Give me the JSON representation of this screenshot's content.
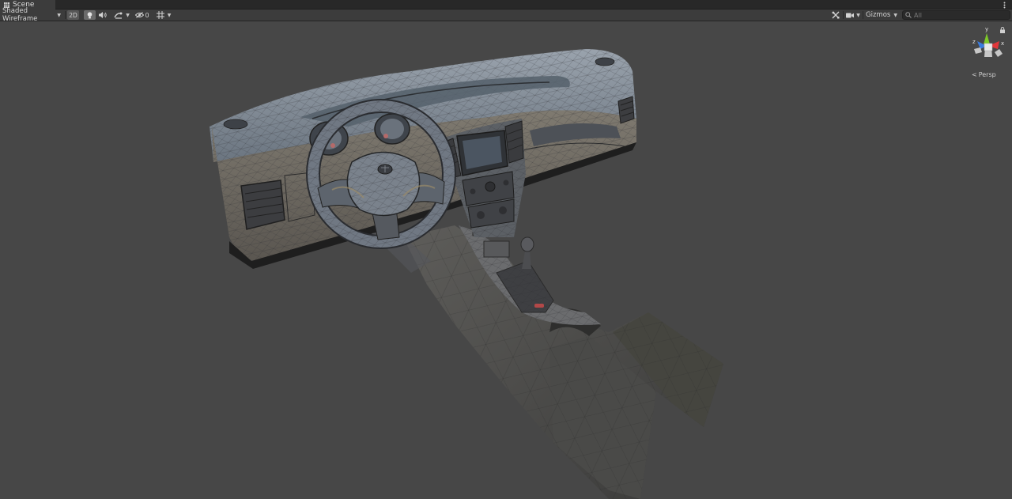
{
  "tab": {
    "title": "Scene",
    "icon": "grid-icon"
  },
  "toolbar": {
    "draw_mode": "Shaded Wireframe",
    "mode_2d": "2D",
    "hidden_count": "0",
    "gizmos_label": "Gizmos",
    "search_placeholder": "All"
  },
  "gizmo": {
    "x_label": "x",
    "y_label": "y",
    "z_label": "z",
    "projection_label": "Persp",
    "colors": {
      "x": "#e0363a",
      "y": "#7ec928",
      "z": "#3a7ce0"
    }
  },
  "icons": [
    "grid-icon",
    "kebab-menu-icon",
    "lightbulb-icon",
    "speaker-icon",
    "effects-icon",
    "hidden-eye-icon",
    "grid-snap-icon",
    "tools-icon",
    "camera-icon",
    "search-icon",
    "lock-icon"
  ]
}
